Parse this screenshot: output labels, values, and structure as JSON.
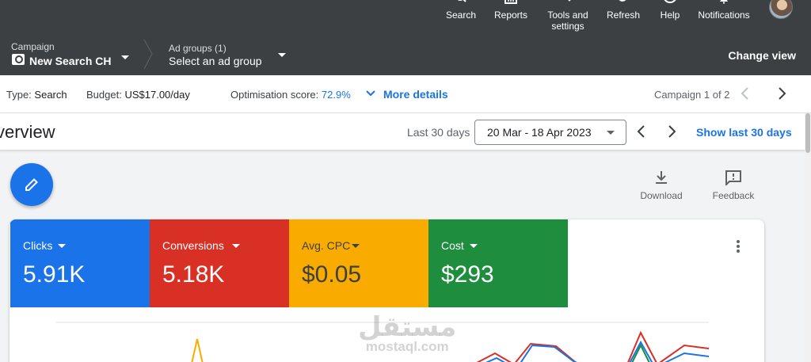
{
  "topbar": {
    "actions": [
      {
        "label": "Search",
        "icon": "search-icon"
      },
      {
        "label": "Reports",
        "icon": "reports-icon"
      },
      {
        "label": "Tools and settings",
        "icon": "wrench-icon"
      },
      {
        "label": "Refresh",
        "icon": "refresh-icon"
      },
      {
        "label": "Help",
        "icon": "help-icon"
      },
      {
        "label": "Notifications",
        "icon": "bell-icon"
      }
    ],
    "tools_line1": "Tools and",
    "tools_line2": "settings"
  },
  "campaign_bar": {
    "campaign_label": "Campaign",
    "campaign_name": "New Search CH",
    "ad_groups_label": "Ad groups (1)",
    "ad_group_value": "Select an ad group",
    "change_view": "Change view"
  },
  "info_bar": {
    "type_label": "Type:",
    "type_value": "Search",
    "budget_label": "Budget:",
    "budget_value": "US$17.00/day",
    "optimisation_label": "Optimisation score:",
    "optimisation_value": "72.9%",
    "more_details": "More details",
    "campaign_count": "Campaign 1 of 2"
  },
  "overview": {
    "title": "verview",
    "range_label": "Last 30 days",
    "date_range": "20 Mar - 18 Apr 2023",
    "show_last": "Show last 30 days"
  },
  "tools": {
    "download": "Download",
    "feedback": "Feedback"
  },
  "metrics": [
    {
      "label": "Clicks",
      "value": "5.91K",
      "color": "#1a73e8",
      "text_color": "#ffffff"
    },
    {
      "label": "Conversions",
      "value": "5.18K",
      "color": "#d93025",
      "text_color": "#ffffff"
    },
    {
      "label": "Avg. CPC",
      "value": "$0.05",
      "color": "#f9ab00",
      "text_color": "#3c4043"
    },
    {
      "label": "Cost",
      "value": "$293",
      "color": "#1e8e3e",
      "text_color": "#ffffff"
    }
  ],
  "watermark": {
    "arabic": "مستقل",
    "latin": "mostaql.com"
  },
  "colors": {
    "topbar_bg": "#3c4043",
    "accent": "#1a73e8"
  }
}
